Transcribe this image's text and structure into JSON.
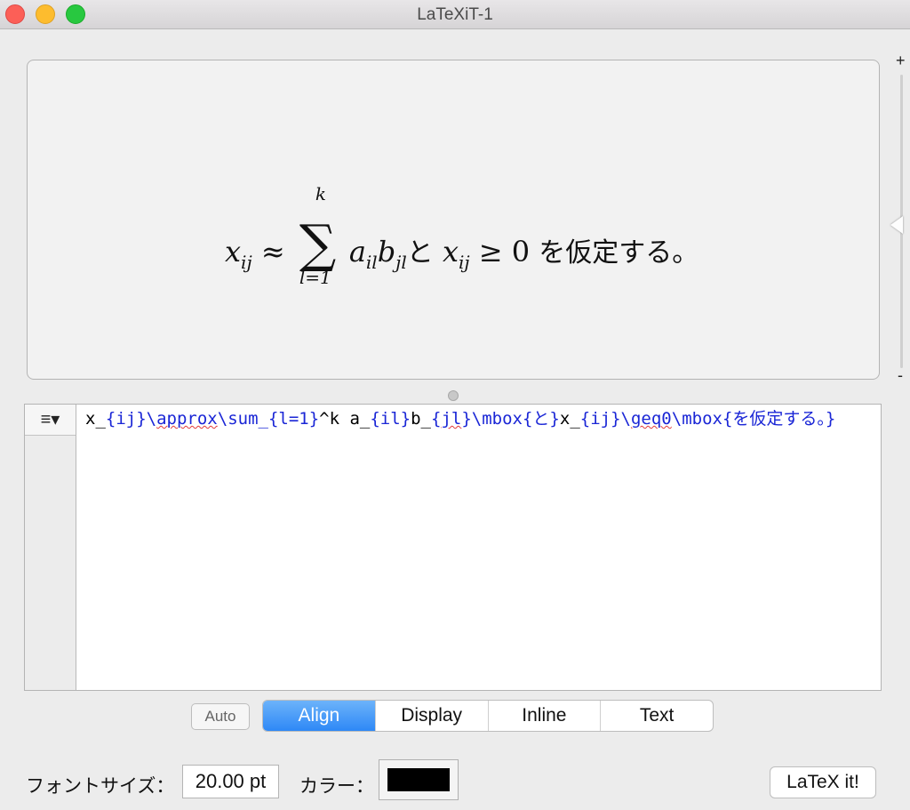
{
  "window": {
    "title": "LaTeXiT-1"
  },
  "preview": {
    "formula": {
      "x": "x",
      "ij": "ij",
      "approx": "≈",
      "sum": "∑",
      "upper": "k",
      "lower": "l=1",
      "a": "a",
      "il": "il",
      "b": "b",
      "jl": "jl",
      "to": "と",
      "geq": "≥",
      "zero": "0",
      "tail": "を仮定する。"
    }
  },
  "slider": {
    "plus": "+",
    "minus": "-"
  },
  "editor": {
    "menu_icon": "≡▾",
    "tokens": {
      "t1": "x_",
      "t2": "{ij}",
      "t3": "\\",
      "t4": "approx",
      "t5": "\\sum_{l=1}",
      "t6": "^k a_",
      "t7": "{il}",
      "t8": "b_",
      "t9": "{",
      "t10": "jl",
      "t11": "}",
      "t12": "\\mbox{と}",
      "t13": "x_",
      "t14": "{ij}",
      "t15": "\\",
      "t16": "geq0",
      "t17": "\\mbox{を仮定する。}"
    }
  },
  "modes": {
    "auto": "Auto",
    "align": "Align",
    "display": "Display",
    "inline": "Inline",
    "text": "Text",
    "selected": "Align"
  },
  "bottom": {
    "font_size_label": "フォントサイズ：",
    "font_size_value": "20.00 pt",
    "color_label": "カラー：",
    "color_value": "#000000",
    "latex_button": "LaTeX it!"
  }
}
